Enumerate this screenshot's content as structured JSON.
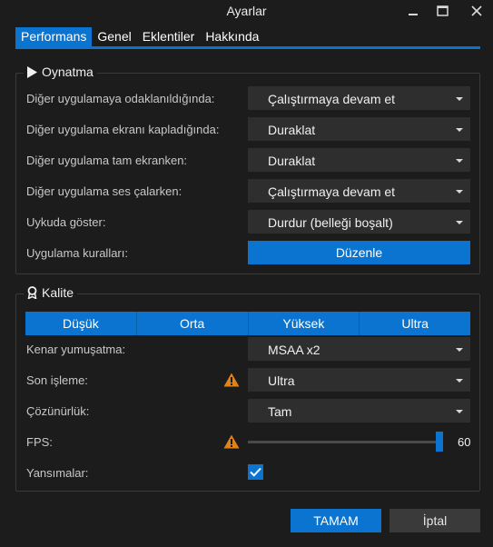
{
  "window": {
    "title": "Ayarlar",
    "controls": {
      "minimize_icon": "minimize-icon",
      "maximize_icon": "maximize-icon",
      "close_icon": "close-icon"
    }
  },
  "tabs": [
    {
      "label": "Performans",
      "active": true
    },
    {
      "label": "Genel",
      "active": false
    },
    {
      "label": "Eklentiler",
      "active": false
    },
    {
      "label": "Hakkında",
      "active": false
    }
  ],
  "playback": {
    "title": "Oynatma",
    "icon": "play-icon",
    "rows": [
      {
        "label": "Diğer uygulamaya odaklanıldığında:",
        "value": "Çalıştırmaya devam et"
      },
      {
        "label": "Diğer uygulama ekranı kapladığında:",
        "value": "Duraklat"
      },
      {
        "label": "Diğer uygulama tam ekranken:",
        "value": "Duraklat"
      },
      {
        "label": "Diğer uygulama ses çalarken:",
        "value": "Çalıştırmaya devam et"
      },
      {
        "label": "Uykuda göster:",
        "value": "Durdur (belleği boşalt)"
      }
    ],
    "rules": {
      "label": "Uygulama kuralları:",
      "button": "Düzenle"
    }
  },
  "quality": {
    "title": "Kalite",
    "icon": "award-icon",
    "presets": [
      "Düşük",
      "Orta",
      "Yüksek",
      "Ultra"
    ],
    "antialias": {
      "label": "Kenar yumuşatma:",
      "value": "MSAA x2"
    },
    "postprocess": {
      "label": "Son işleme:",
      "value": "Ultra",
      "warning": true
    },
    "resolution": {
      "label": "Çözünürlük:",
      "value": "Tam"
    },
    "fps": {
      "label": "FPS:",
      "value": "60",
      "level": 1.0,
      "warning": true
    },
    "reflections": {
      "label": "Yansımalar:",
      "checked": true
    }
  },
  "footer": {
    "ok": "TAMAM",
    "cancel": "İptal"
  },
  "colors": {
    "accent": "#0b74d0",
    "warning": "#e0821c",
    "background": "#1c1c1c",
    "control": "#2e2e2e"
  }
}
